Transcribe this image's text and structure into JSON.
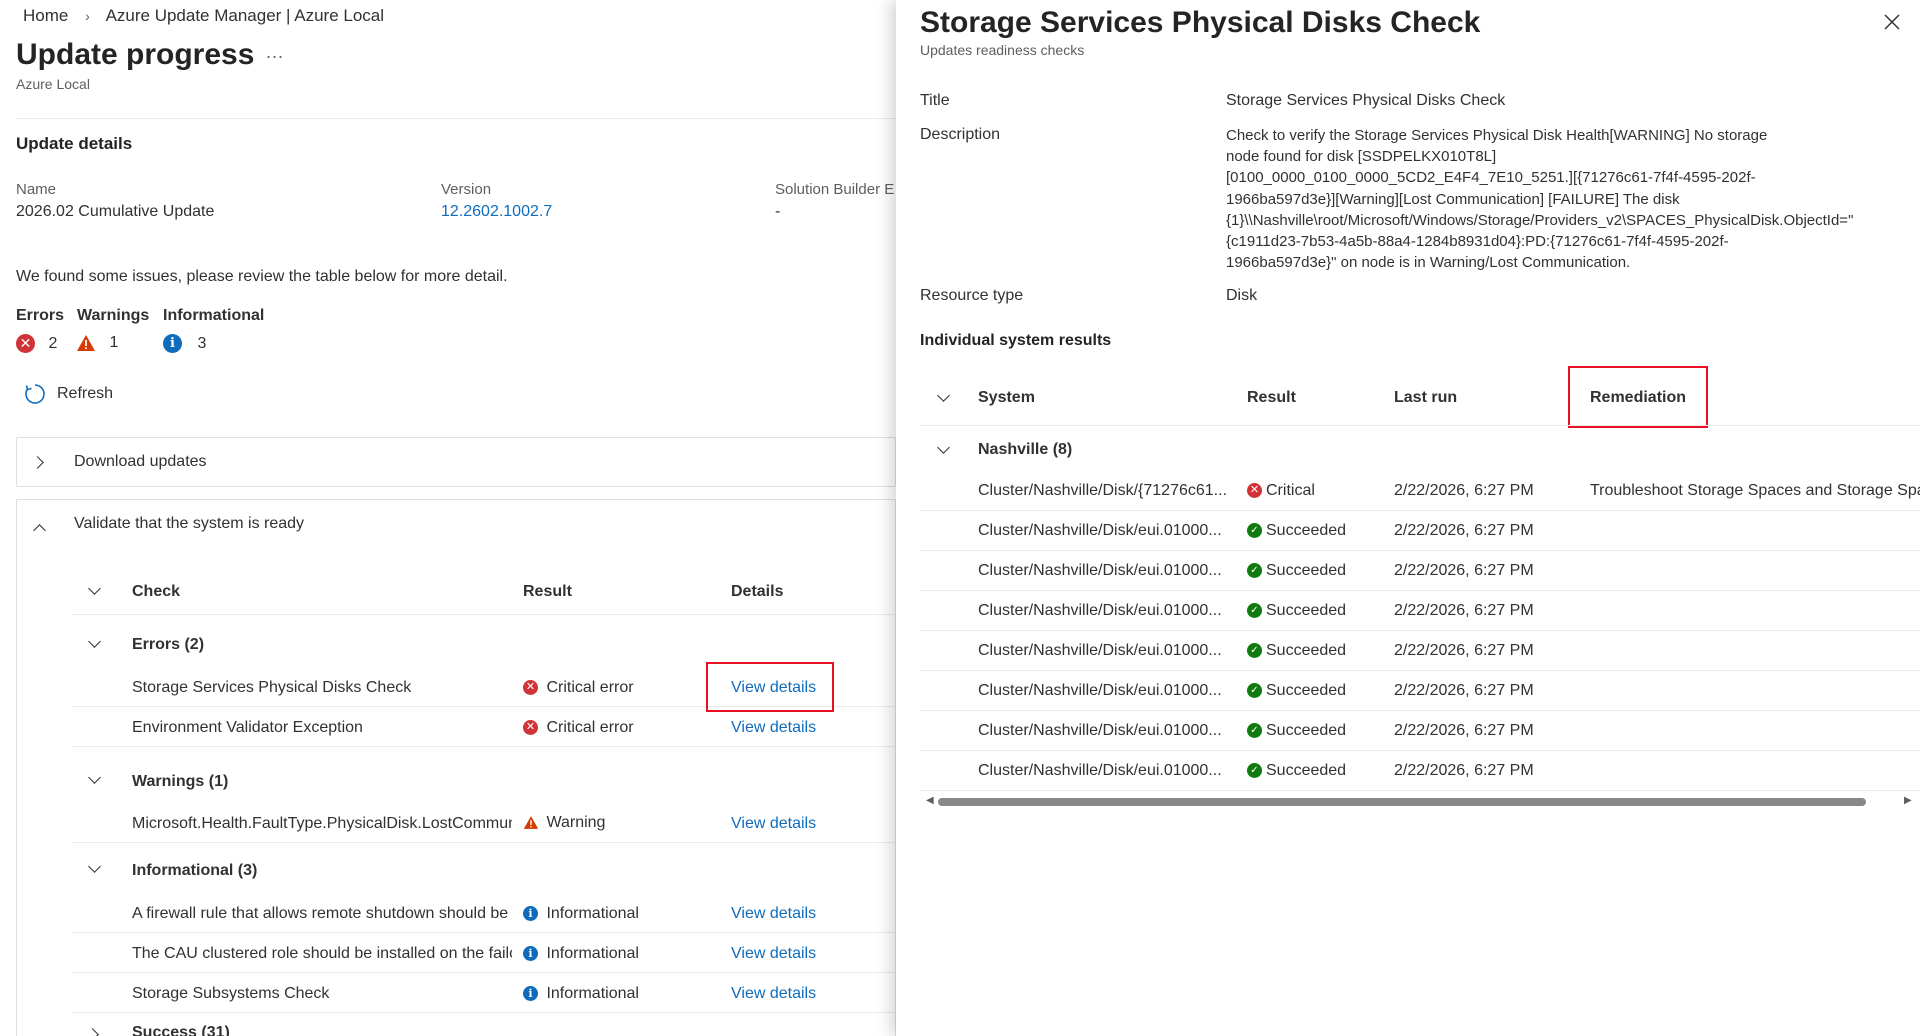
{
  "breadcrumb": {
    "home": "Home",
    "current": "Azure Update Manager | Azure Local"
  },
  "page": {
    "title": "Update progress",
    "more": "...",
    "subtitle": "Azure Local"
  },
  "update_details": {
    "heading": "Update details",
    "name_label": "Name",
    "name_value": "2026.02 Cumulative Update",
    "version_label": "Version",
    "version_value": "12.2602.1002.7",
    "sbe_label": "Solution Builder E",
    "sbe_value": "-"
  },
  "issues_text": "We found some issues, please review the table below for more detail.",
  "summary": {
    "errors_label": "Errors",
    "errors_count": "2",
    "warnings_label": "Warnings",
    "warnings_count": "1",
    "info_label": "Informational",
    "info_count": "3"
  },
  "refresh_label": "Refresh",
  "steps": {
    "download": "Download updates",
    "validate": "Validate that the system is ready"
  },
  "check_table": {
    "col_check": "Check",
    "col_result": "Result",
    "col_details": "Details",
    "group_errors": "Errors (2)",
    "group_warnings": "Warnings (1)",
    "group_info": "Informational (3)",
    "group_success": "Success (31)",
    "view_details": "View details",
    "rows": [
      {
        "check": "Storage Services Physical Disks Check",
        "result": "Critical error"
      },
      {
        "check": "Environment Validator Exception",
        "result": "Critical error"
      },
      {
        "check": "Microsoft.Health.FaultType.PhysicalDisk.LostCommuni",
        "result": "Warning"
      },
      {
        "check": "A firewall rule that allows remote shutdown should be",
        "result": "Informational"
      },
      {
        "check": "The CAU clustered role should be installed on the failc",
        "result": "Informational"
      },
      {
        "check": "Storage Subsystems Check",
        "result": "Informational"
      }
    ]
  },
  "panel": {
    "title": "Storage Services Physical Disks Check",
    "subtitle": "Updates readiness checks",
    "title_label": "Title",
    "title_value": "Storage Services Physical Disks Check",
    "description_label": "Description",
    "description_lines": [
      "Check to verify the Storage Services Physical Disk Health[WARNING] No storage",
      "node found for disk [SSDPELKX010T8L]",
      "[0100_0000_0100_0000_5CD2_E4F4_7E10_5251.][{71276c61-7f4f-4595-202f-",
      "1966ba597d3e}][Warning][Lost Communication] [FAILURE] The disk",
      "{1}\\\\Nashville\\root/Microsoft/Windows/Storage/Providers_v2\\SPACES_PhysicalDisk.ObjectId=\"",
      "{c1911d23-7b53-4a5b-88a4-1284b8931d04}:PD:{71276c61-7f4f-4595-202f-",
      "1966ba597d3e}\" on node is in Warning/Lost Communication."
    ],
    "resource_type_label": "Resource type",
    "resource_type_value": "Disk",
    "results_heading": "Individual system results",
    "col_system": "System",
    "col_result": "Result",
    "col_last_run": "Last run",
    "col_remediation": "Remediation",
    "group": "Nashville (8)",
    "rows": [
      {
        "system": "Cluster/Nashville/Disk/{71276c61...",
        "result": "Critical",
        "status": "critical",
        "last_run": "2/22/2026, 6:27 PM",
        "remediation": "Troubleshoot Storage Spaces and Storage Spac"
      },
      {
        "system": "Cluster/Nashville/Disk/eui.01000...",
        "result": "Succeeded",
        "status": "ok",
        "last_run": "2/22/2026, 6:27 PM",
        "remediation": ""
      },
      {
        "system": "Cluster/Nashville/Disk/eui.01000...",
        "result": "Succeeded",
        "status": "ok",
        "last_run": "2/22/2026, 6:27 PM",
        "remediation": ""
      },
      {
        "system": "Cluster/Nashville/Disk/eui.01000...",
        "result": "Succeeded",
        "status": "ok",
        "last_run": "2/22/2026, 6:27 PM",
        "remediation": ""
      },
      {
        "system": "Cluster/Nashville/Disk/eui.01000...",
        "result": "Succeeded",
        "status": "ok",
        "last_run": "2/22/2026, 6:27 PM",
        "remediation": ""
      },
      {
        "system": "Cluster/Nashville/Disk/eui.01000...",
        "result": "Succeeded",
        "status": "ok",
        "last_run": "2/22/2026, 6:27 PM",
        "remediation": ""
      },
      {
        "system": "Cluster/Nashville/Disk/eui.01000...",
        "result": "Succeeded",
        "status": "ok",
        "last_run": "2/22/2026, 6:27 PM",
        "remediation": ""
      },
      {
        "system": "Cluster/Nashville/Disk/eui.01000...",
        "result": "Succeeded",
        "status": "ok",
        "last_run": "2/22/2026, 6:27 PM",
        "remediation": ""
      }
    ]
  },
  "colors": {
    "accent": "#0f6cbd",
    "error": "#d13438",
    "warning": "#d83b01",
    "success": "#107c10",
    "highlight": "#e81123"
  }
}
